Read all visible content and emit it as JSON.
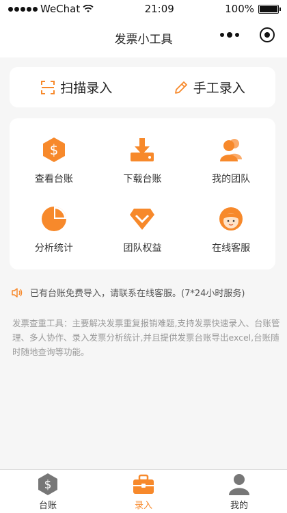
{
  "status_bar": {
    "carrier": "WeChat",
    "time": "21:09",
    "battery": "100%"
  },
  "nav": {
    "title": "发票小工具"
  },
  "entry": {
    "scan_label": "扫描录入",
    "manual_label": "手工录入"
  },
  "grid": {
    "items": [
      {
        "label": "查看台账",
        "icon": "dollar-hexagon-icon"
      },
      {
        "label": "下载台账",
        "icon": "download-icon"
      },
      {
        "label": "我的团队",
        "icon": "team-icon"
      },
      {
        "label": "分析统计",
        "icon": "pie-chart-icon"
      },
      {
        "label": "团队权益",
        "icon": "diamond-icon"
      },
      {
        "label": "在线客服",
        "icon": "customer-service-icon"
      }
    ]
  },
  "notice": {
    "text": "已有台账免费导入，请联系在线客服。(7*24小时服务)"
  },
  "description": {
    "text": "发票查重工具：主要解决发票重复报销难题,支持发票快速录入、台账管理、多人协作、录入发票分析统计,并且提供发票台账导出excel,台账随时随地查询等功能。"
  },
  "tabs": [
    {
      "label": "台账",
      "icon": "ledger-icon",
      "active": false
    },
    {
      "label": "录入",
      "icon": "briefcase-icon",
      "active": true
    },
    {
      "label": "我的",
      "icon": "profile-icon",
      "active": false
    }
  ],
  "colors": {
    "accent": "#f7892b",
    "background": "#f6f6f6",
    "tab_inactive_icon": "#777777"
  }
}
